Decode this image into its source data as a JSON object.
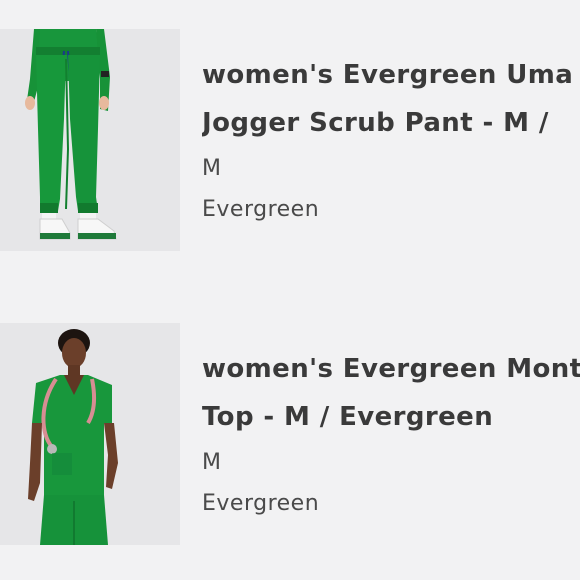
{
  "items": [
    {
      "title_line1": "women's Evergreen Uma",
      "title_line2": "Jogger Scrub Pant - M /",
      "size": "M",
      "color_name": "Evergreen",
      "image_icon": "product-photo-jogger-pants"
    },
    {
      "title_line1": "women's Evergreen Mont",
      "title_line2": "Top - M / Evergreen",
      "size": "M",
      "color_name": "Evergreen",
      "image_icon": "product-photo-scrub-top"
    }
  ],
  "colors": {
    "background": "#f2f2f3",
    "thumbnail_bg": "#e6e6e8",
    "scrub_green": "#16963b",
    "text": "#3a3a3a"
  }
}
